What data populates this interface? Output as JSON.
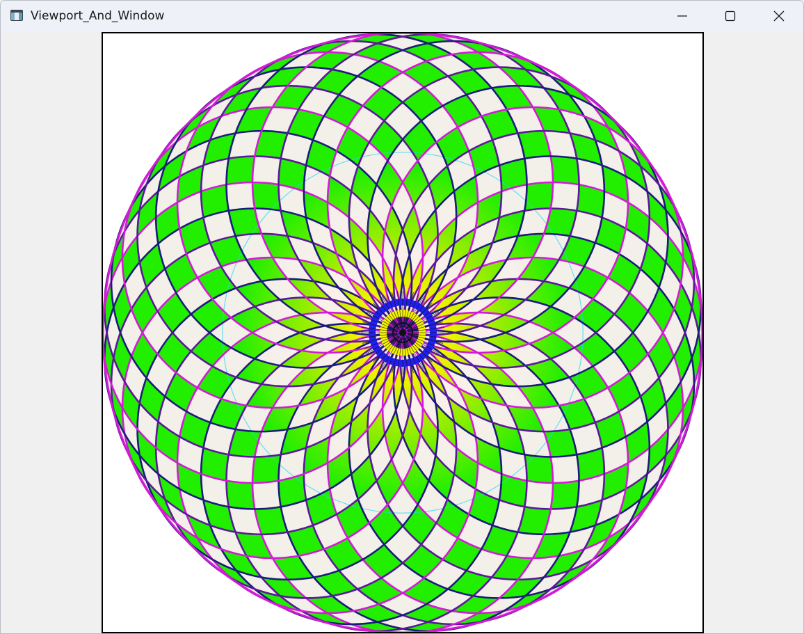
{
  "window": {
    "title": "Viewport_And_Window",
    "controls": {
      "minimize": "minimize-icon",
      "maximize": "maximize-icon",
      "close": "close-icon"
    }
  },
  "colors": {
    "titlebar": "#eef2f8",
    "client_background": "#f0f0f0",
    "viewport_border": "#000000",
    "viewport_background": "#ffffff",
    "rose_green": "#22ee00",
    "rose_pale": "#fbeff3",
    "rose_lime": "#a4ee00",
    "rose_cyan": "#29d6f0",
    "outline_purple": "#5a189a",
    "outline_magenta": "#d21bd6",
    "outline_navy": "#1b1b7a",
    "center_blue": "#1f1ff0",
    "center_yellow": "#f7f300",
    "center_dark": "#101010"
  },
  "figure": {
    "type": "circle-rose-pattern",
    "circle_count": 36
  }
}
